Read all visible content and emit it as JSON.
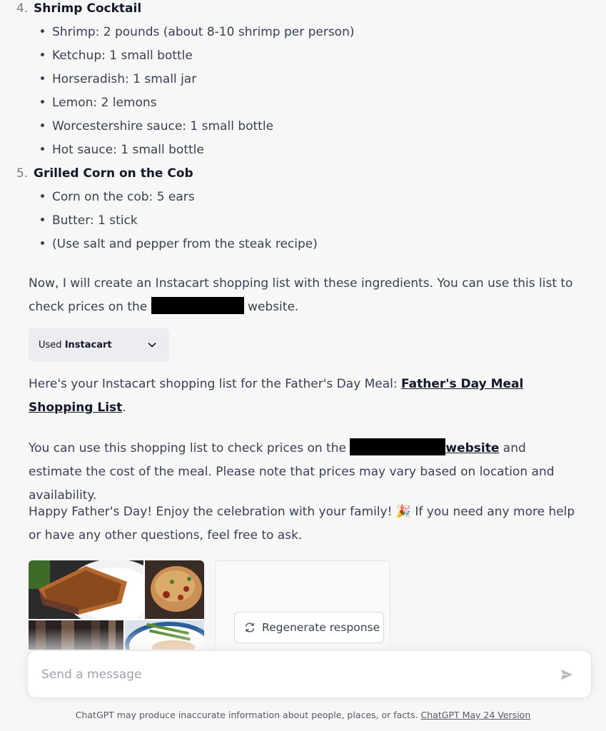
{
  "list": {
    "item4": {
      "number": "4.",
      "title": "Shrimp Cocktail",
      "bullets": [
        "Shrimp: 2 pounds (about 8-10 shrimp per person)",
        "Ketchup: 1 small bottle",
        "Horseradish: 1 small jar",
        "Lemon: 2 lemons",
        "Worcestershire sauce: 1 small bottle",
        "Hot sauce: 1 small bottle"
      ]
    },
    "item5": {
      "number": "5.",
      "title": "Grilled Corn on the Cob",
      "bullets": [
        "Corn on the cob: 5 ears",
        "Butter: 1 stick",
        "(Use salt and pepper from the steak recipe)"
      ]
    }
  },
  "para1": {
    "line1": "Now, I will create an Instacart shopping list with these ingredients. You can use this list to",
    "line2_before": "check prices on the",
    "line2_after": "website."
  },
  "tool": {
    "prefix": "Used",
    "name": "Instacart"
  },
  "para2": {
    "before": "Here's your Instacart shopping list for the Father's Day Meal:",
    "link": "Father's Day Meal Shopping List",
    "after": "."
  },
  "para3": {
    "before": "You can use this shopping list to check prices on the",
    "link": "website",
    "after": "and estimate the cost of the meal. Please note that prices may vary based on location and availability."
  },
  "para4": {
    "before": "Happy Father's Day! Enjoy the celebration with your family!",
    "emoji": "🎉",
    "after": "If you need any more help or have any other questions, feel free to ask."
  },
  "regenerate": {
    "label": "Regenerate response"
  },
  "composer": {
    "placeholder": "Send a message"
  },
  "footer": {
    "text": "ChatGPT may produce inaccurate information about people, places, or facts.",
    "link": "ChatGPT May 24 Version"
  },
  "icons": {
    "chevron": "chevron-down-icon",
    "regenerate": "refresh-icon",
    "send": "send-icon"
  },
  "colors": {
    "background": "#f7f7f8",
    "text": "#374151",
    "heading": "#111827",
    "chip": "#ececf1",
    "redaction": "#000000"
  }
}
